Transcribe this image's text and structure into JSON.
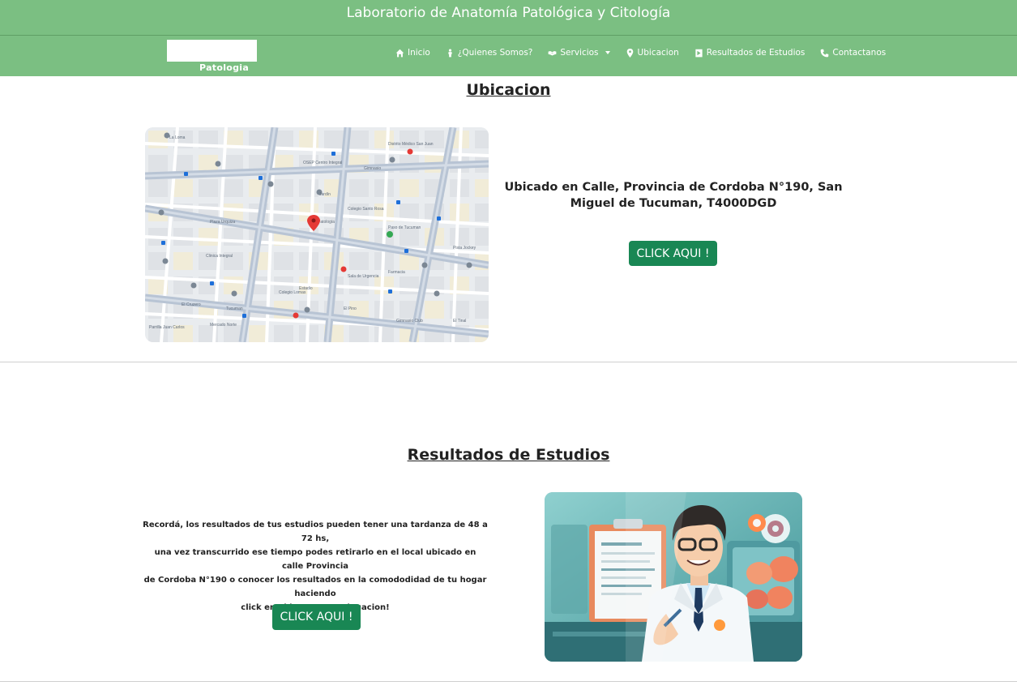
{
  "header": {
    "title": "Laboratorio de Anatomía Patológica y Citología"
  },
  "brand": {
    "logo_text": "Patologia"
  },
  "nav": [
    {
      "label": "Inicio",
      "icon": "home-icon"
    },
    {
      "label": "¿Quienes Somos?",
      "icon": "person-icon"
    },
    {
      "label": "Servicios",
      "icon": "handshake-icon",
      "dropdown": true
    },
    {
      "label": "Ubicacion",
      "icon": "location-pin-icon"
    },
    {
      "label": "Resultados de Estudios",
      "icon": "document-icon"
    },
    {
      "label": "Contactanos",
      "icon": "phone-icon"
    }
  ],
  "location": {
    "heading": "Ubicacion",
    "address": "Ubicado en Calle, Provincia de Cordoba N°190, San Miguel de Tucuman, T4000DGD",
    "button_label": "CLICK AQUI !",
    "map": {
      "labels": [
        "La Loma",
        "Distrito Médico San Juan",
        "OSEP Centro Integral",
        "Gimnasio",
        "Jardín",
        "Colegio Santo Rosa",
        "Patologia",
        "Plaza Urquiza",
        "Clinica Integral",
        "Sala de Urgencia",
        "Farmacia",
        "Colegio Lomas",
        "El Cruzero",
        "Tucuman",
        "Estadio",
        "Gimnasio Club",
        "El Tinal",
        "Parrilla Juan Carlos",
        "Pista Jockey",
        "Mercado Norte",
        "Paso de Tucuman",
        "El Pino"
      ]
    }
  },
  "results": {
    "heading": "Resultados de Estudios",
    "lines": [
      "Recordá, los resultados de tus estudios pueden tener una tardanza de 48 a 72 hs,",
      "una vez transcurrido ese tiempo podes retirarlo en el local ubicado en calle Provincia",
      "de Cordoba N°190 o conocer los resultados en la comododidad de tu hogar haciendo",
      "click en el boton a continuacion!"
    ],
    "button_label": "CLICK AQUI !"
  },
  "colors": {
    "header_green": "#7bbf82",
    "button_green": "#198754",
    "map_road": "#b8c4d4",
    "map_pin": "#e53935"
  }
}
